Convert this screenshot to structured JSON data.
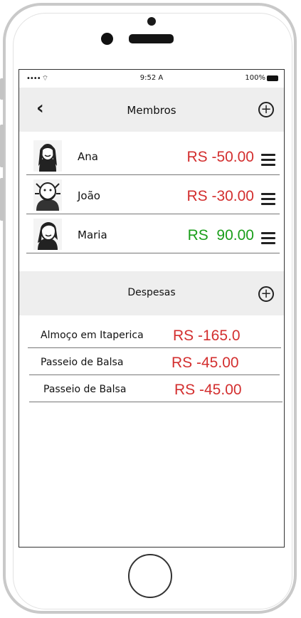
{
  "status_bar": {
    "signal": "•••• ",
    "time": "9:52 A",
    "battery": "100%"
  },
  "header": {
    "title": "Membros",
    "back_icon": "chevron-left-icon",
    "add_icon": "plus-circle-icon"
  },
  "members": [
    {
      "name": "Ana",
      "amount": "RS -50.00",
      "color": "#d32f2f"
    },
    {
      "name": "João",
      "amount": "RS -30.00",
      "color": "#d32f2f"
    },
    {
      "name": "Maria",
      "amount": "RS  90.00",
      "color": "#1a9e1a"
    }
  ],
  "expenses_section": {
    "title": "Despesas",
    "add_icon": "plus-circle-icon"
  },
  "expenses": [
    {
      "name": "Almoço em Itaperica",
      "amount": "RS -165.0",
      "color": "#d32f2f"
    },
    {
      "name": "Passeio de Balsa",
      "amount": "RS -45.00",
      "color": "#d32f2f"
    },
    {
      "name": "Passeio de Balsa",
      "amount": "RS -45.00",
      "color": "#d32f2f"
    }
  ]
}
